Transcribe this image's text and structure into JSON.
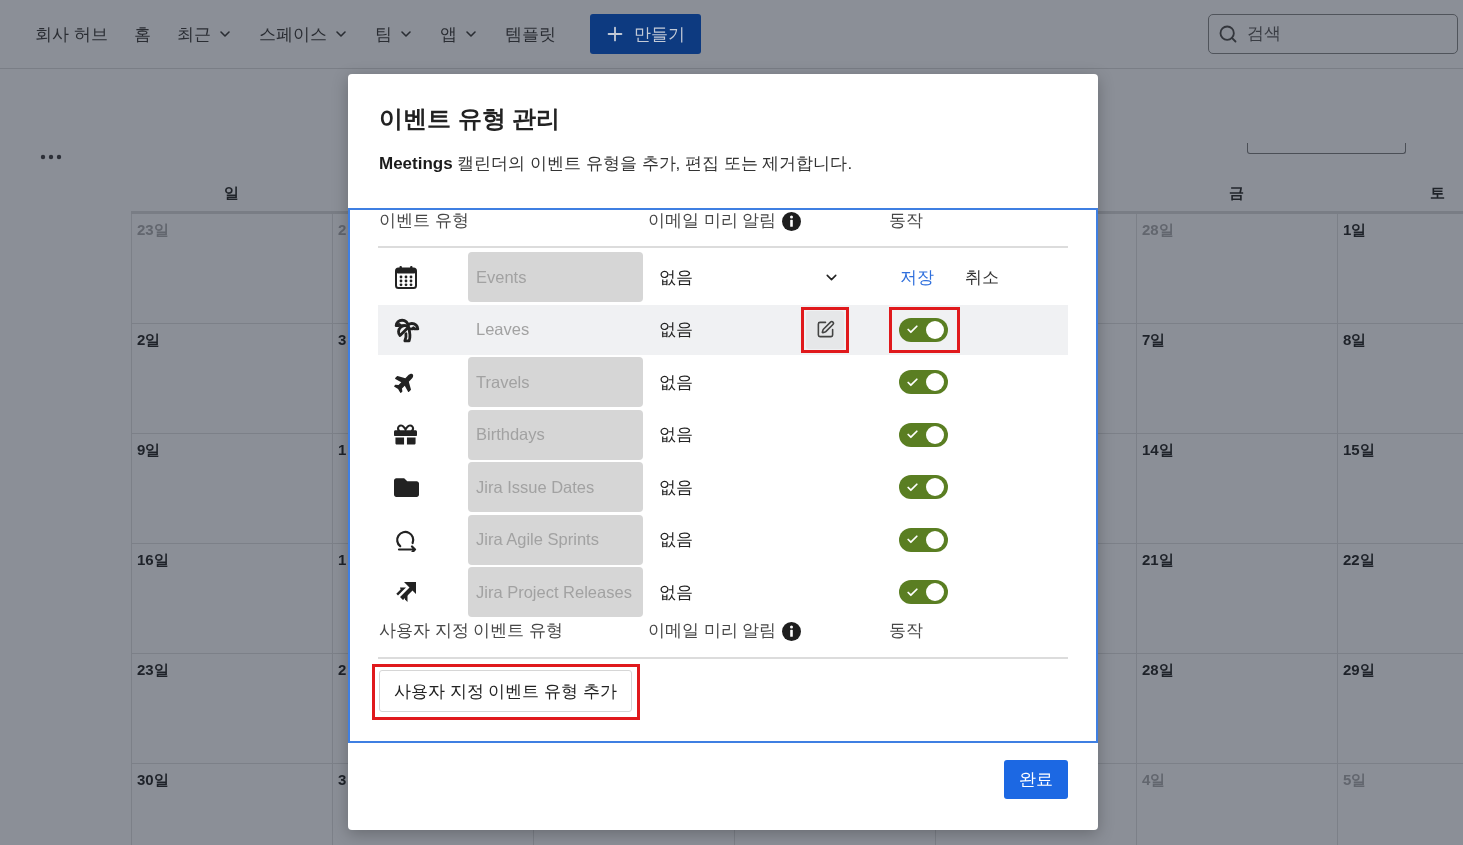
{
  "top_nav": {
    "items": [
      {
        "label": "회사 허브",
        "dropdown": false
      },
      {
        "label": "홈",
        "dropdown": false
      },
      {
        "label": "최근",
        "dropdown": true
      },
      {
        "label": "스페이스",
        "dropdown": true
      },
      {
        "label": "팀",
        "dropdown": true
      },
      {
        "label": "앱",
        "dropdown": true
      },
      {
        "label": "템플릿",
        "dropdown": false
      }
    ],
    "create_button": "만들기",
    "search": {
      "placeholder": "검색"
    }
  },
  "calendar": {
    "left_columns": [
      {
        "heading": "일",
        "days": [
          {
            "label": "23일",
            "muted": true
          },
          {
            "label": "2일",
            "muted": false
          },
          {
            "label": "9일",
            "muted": false
          },
          {
            "label": "16일",
            "muted": false
          },
          {
            "label": "23일",
            "muted": false
          },
          {
            "label": "30일",
            "muted": false
          }
        ]
      },
      {
        "days": [
          {
            "label": "2",
            "muted": true
          },
          {
            "label": "3",
            "muted": false
          },
          {
            "label": "1",
            "muted": false
          },
          {
            "label": "1",
            "muted": false
          },
          {
            "label": "2",
            "muted": false
          },
          {
            "label": "3",
            "muted": false
          }
        ]
      }
    ],
    "right_columns": [
      {
        "heading": "금",
        "days": [
          {
            "label": "28일",
            "muted": true
          },
          {
            "label": "7일",
            "muted": false
          },
          {
            "label": "14일",
            "muted": false
          },
          {
            "label": "21일",
            "muted": false
          },
          {
            "label": "28일",
            "muted": false
          },
          {
            "label": "4일",
            "muted": true
          }
        ]
      },
      {
        "heading": "토",
        "days": [
          {
            "label": "1일",
            "muted": false
          },
          {
            "label": "8일",
            "muted": false
          },
          {
            "label": "15일",
            "muted": false
          },
          {
            "label": "22일",
            "muted": false
          },
          {
            "label": "29일",
            "muted": false
          },
          {
            "label": "5일",
            "muted": true
          }
        ]
      }
    ]
  },
  "dialog": {
    "title": "이벤트 유형 관리",
    "description": "**Meetings** 캘린더의 이벤트 유형을 추가, 편집 또는 제거합니다.",
    "event_types": {
      "columns": [
        {
          "label": "이벤트 유형",
          "info": false
        },
        {
          "label": "이메일 미리 알림",
          "info": true
        },
        {
          "label": "동작",
          "info": false
        }
      ],
      "rows": [
        {
          "kind": "editing",
          "name": "Events",
          "reminder": "없음",
          "highlighted": false,
          "marked": false,
          "actions": [
            {
              "label": "저장",
              "primary": true
            },
            {
              "label": "취소",
              "primary": false
            }
          ]
        },
        {
          "kind": "toggle",
          "name": "Leaves",
          "reminder": "없음",
          "highlighted": true,
          "marked": true,
          "on": true
        },
        {
          "kind": "toggle",
          "name": "Travels",
          "reminder": "없음",
          "highlighted": false,
          "marked": false,
          "on": true
        },
        {
          "kind": "toggle",
          "name": "Birthdays",
          "reminder": "없음",
          "highlighted": false,
          "marked": false,
          "on": true
        },
        {
          "kind": "toggle",
          "name": "Jira Issue Dates",
          "reminder": "없음",
          "highlighted": false,
          "marked": false,
          "on": true
        },
        {
          "kind": "toggle",
          "name": "Jira Agile Sprints",
          "reminder": "없음",
          "highlighted": false,
          "marked": false,
          "on": true
        },
        {
          "kind": "toggle",
          "name": "Jira Project Releases",
          "reminder": "없음",
          "highlighted": false,
          "marked": false,
          "on": true
        }
      ]
    },
    "custom_types": {
      "columns": [
        {
          "label": "사용자 지정 이벤트 유형",
          "info": false
        },
        {
          "label": "이메일 미리 알림",
          "info": true
        },
        {
          "label": "동작",
          "info": false
        }
      ],
      "add_button": {
        "label": "사용자 지정 이벤트 유형 추가",
        "marked": true
      }
    },
    "done_button": "완료"
  }
}
